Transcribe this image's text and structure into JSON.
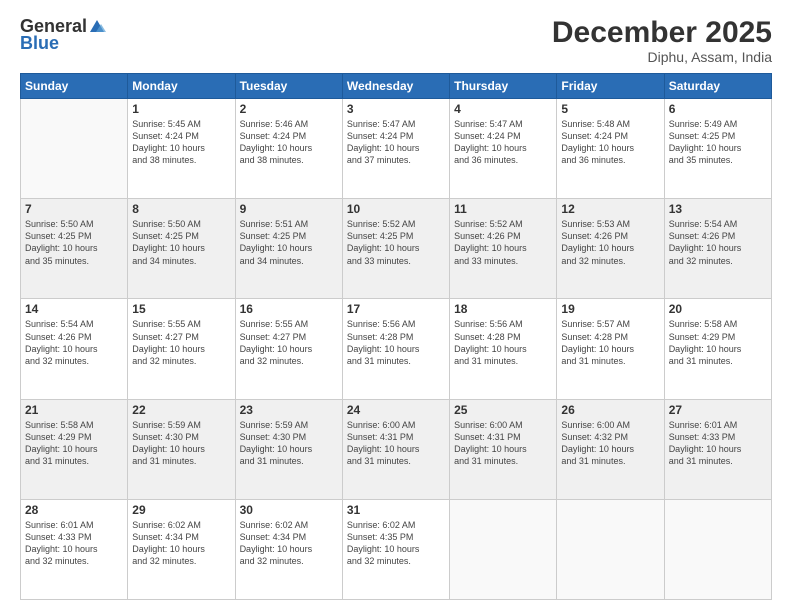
{
  "header": {
    "logo_general": "General",
    "logo_blue": "Blue",
    "title": "December 2025",
    "location": "Diphu, Assam, India"
  },
  "days_of_week": [
    "Sunday",
    "Monday",
    "Tuesday",
    "Wednesday",
    "Thursday",
    "Friday",
    "Saturday"
  ],
  "weeks": [
    {
      "shaded": false,
      "days": [
        {
          "num": "",
          "data": ""
        },
        {
          "num": "1",
          "data": "Sunrise: 5:45 AM\nSunset: 4:24 PM\nDaylight: 10 hours\nand 38 minutes."
        },
        {
          "num": "2",
          "data": "Sunrise: 5:46 AM\nSunset: 4:24 PM\nDaylight: 10 hours\nand 38 minutes."
        },
        {
          "num": "3",
          "data": "Sunrise: 5:47 AM\nSunset: 4:24 PM\nDaylight: 10 hours\nand 37 minutes."
        },
        {
          "num": "4",
          "data": "Sunrise: 5:47 AM\nSunset: 4:24 PM\nDaylight: 10 hours\nand 36 minutes."
        },
        {
          "num": "5",
          "data": "Sunrise: 5:48 AM\nSunset: 4:24 PM\nDaylight: 10 hours\nand 36 minutes."
        },
        {
          "num": "6",
          "data": "Sunrise: 5:49 AM\nSunset: 4:25 PM\nDaylight: 10 hours\nand 35 minutes."
        }
      ]
    },
    {
      "shaded": true,
      "days": [
        {
          "num": "7",
          "data": "Sunrise: 5:50 AM\nSunset: 4:25 PM\nDaylight: 10 hours\nand 35 minutes."
        },
        {
          "num": "8",
          "data": "Sunrise: 5:50 AM\nSunset: 4:25 PM\nDaylight: 10 hours\nand 34 minutes."
        },
        {
          "num": "9",
          "data": "Sunrise: 5:51 AM\nSunset: 4:25 PM\nDaylight: 10 hours\nand 34 minutes."
        },
        {
          "num": "10",
          "data": "Sunrise: 5:52 AM\nSunset: 4:25 PM\nDaylight: 10 hours\nand 33 minutes."
        },
        {
          "num": "11",
          "data": "Sunrise: 5:52 AM\nSunset: 4:26 PM\nDaylight: 10 hours\nand 33 minutes."
        },
        {
          "num": "12",
          "data": "Sunrise: 5:53 AM\nSunset: 4:26 PM\nDaylight: 10 hours\nand 32 minutes."
        },
        {
          "num": "13",
          "data": "Sunrise: 5:54 AM\nSunset: 4:26 PM\nDaylight: 10 hours\nand 32 minutes."
        }
      ]
    },
    {
      "shaded": false,
      "days": [
        {
          "num": "14",
          "data": "Sunrise: 5:54 AM\nSunset: 4:26 PM\nDaylight: 10 hours\nand 32 minutes."
        },
        {
          "num": "15",
          "data": "Sunrise: 5:55 AM\nSunset: 4:27 PM\nDaylight: 10 hours\nand 32 minutes."
        },
        {
          "num": "16",
          "data": "Sunrise: 5:55 AM\nSunset: 4:27 PM\nDaylight: 10 hours\nand 32 minutes."
        },
        {
          "num": "17",
          "data": "Sunrise: 5:56 AM\nSunset: 4:28 PM\nDaylight: 10 hours\nand 31 minutes."
        },
        {
          "num": "18",
          "data": "Sunrise: 5:56 AM\nSunset: 4:28 PM\nDaylight: 10 hours\nand 31 minutes."
        },
        {
          "num": "19",
          "data": "Sunrise: 5:57 AM\nSunset: 4:28 PM\nDaylight: 10 hours\nand 31 minutes."
        },
        {
          "num": "20",
          "data": "Sunrise: 5:58 AM\nSunset: 4:29 PM\nDaylight: 10 hours\nand 31 minutes."
        }
      ]
    },
    {
      "shaded": true,
      "days": [
        {
          "num": "21",
          "data": "Sunrise: 5:58 AM\nSunset: 4:29 PM\nDaylight: 10 hours\nand 31 minutes."
        },
        {
          "num": "22",
          "data": "Sunrise: 5:59 AM\nSunset: 4:30 PM\nDaylight: 10 hours\nand 31 minutes."
        },
        {
          "num": "23",
          "data": "Sunrise: 5:59 AM\nSunset: 4:30 PM\nDaylight: 10 hours\nand 31 minutes."
        },
        {
          "num": "24",
          "data": "Sunrise: 6:00 AM\nSunset: 4:31 PM\nDaylight: 10 hours\nand 31 minutes."
        },
        {
          "num": "25",
          "data": "Sunrise: 6:00 AM\nSunset: 4:31 PM\nDaylight: 10 hours\nand 31 minutes."
        },
        {
          "num": "26",
          "data": "Sunrise: 6:00 AM\nSunset: 4:32 PM\nDaylight: 10 hours\nand 31 minutes."
        },
        {
          "num": "27",
          "data": "Sunrise: 6:01 AM\nSunset: 4:33 PM\nDaylight: 10 hours\nand 31 minutes."
        }
      ]
    },
    {
      "shaded": false,
      "days": [
        {
          "num": "28",
          "data": "Sunrise: 6:01 AM\nSunset: 4:33 PM\nDaylight: 10 hours\nand 32 minutes."
        },
        {
          "num": "29",
          "data": "Sunrise: 6:02 AM\nSunset: 4:34 PM\nDaylight: 10 hours\nand 32 minutes."
        },
        {
          "num": "30",
          "data": "Sunrise: 6:02 AM\nSunset: 4:34 PM\nDaylight: 10 hours\nand 32 minutes."
        },
        {
          "num": "31",
          "data": "Sunrise: 6:02 AM\nSunset: 4:35 PM\nDaylight: 10 hours\nand 32 minutes."
        },
        {
          "num": "",
          "data": ""
        },
        {
          "num": "",
          "data": ""
        },
        {
          "num": "",
          "data": ""
        }
      ]
    }
  ]
}
